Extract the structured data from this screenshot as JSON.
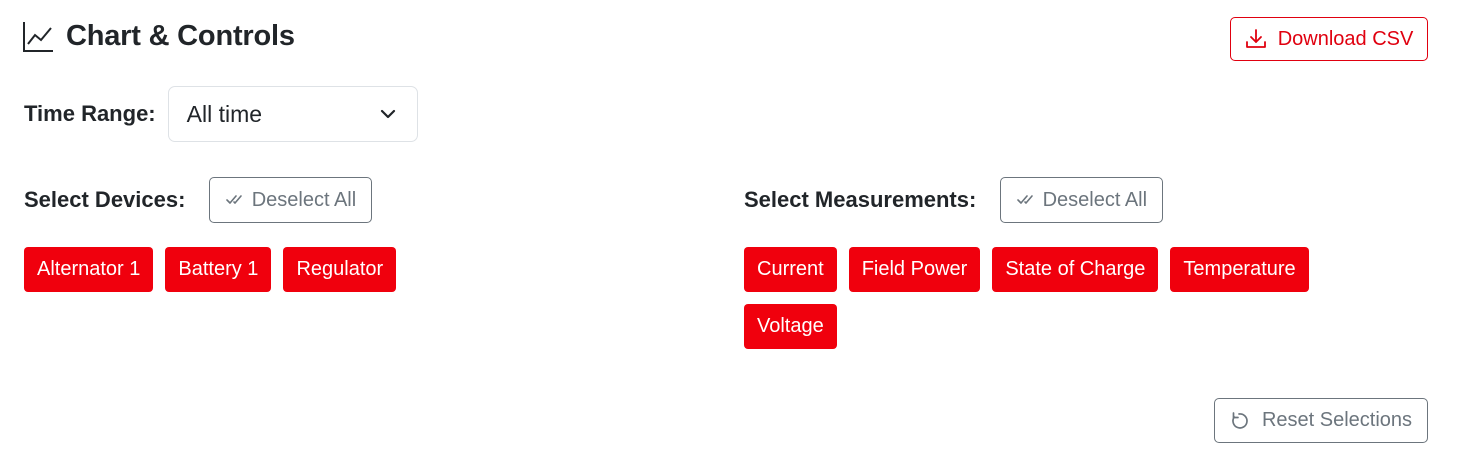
{
  "header": {
    "title": "Chart & Controls",
    "icon": "line-chart-icon"
  },
  "download": {
    "label": "Download CSV",
    "icon": "download-icon",
    "color": "#e0000f"
  },
  "time_range": {
    "label": "Time Range:",
    "selected": "All time"
  },
  "devices": {
    "label": "Select Devices:",
    "deselect_label": "Deselect All",
    "items": [
      "Alternator 1",
      "Battery 1",
      "Regulator"
    ]
  },
  "measurements": {
    "label": "Select Measurements:",
    "deselect_label": "Deselect All",
    "items": [
      "Current",
      "Field Power",
      "State of Charge",
      "Temperature",
      "Voltage"
    ]
  },
  "reset": {
    "label": "Reset Selections",
    "icon": "reset-icon"
  },
  "colors": {
    "accent": "#f0000d",
    "muted": "#6c757d",
    "text": "#212529"
  }
}
